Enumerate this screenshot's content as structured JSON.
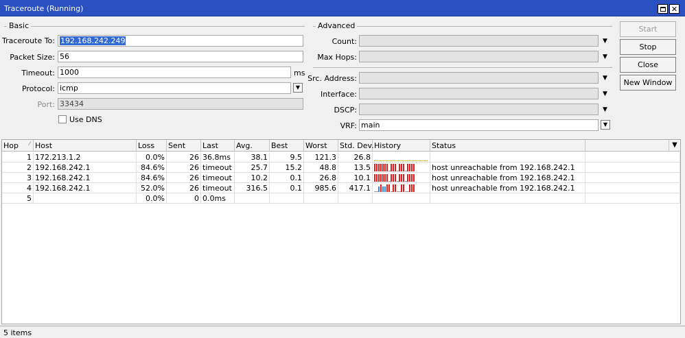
{
  "window": {
    "title": "Traceroute (Running)"
  },
  "basic": {
    "legend": "Basic",
    "traceroute_to_label": "Traceroute To:",
    "traceroute_to_value": "192.168.242.249",
    "packet_size_label": "Packet Size:",
    "packet_size_value": "56",
    "timeout_label": "Timeout:",
    "timeout_value": "1000",
    "timeout_unit": "ms",
    "protocol_label": "Protocol:",
    "protocol_value": "icmp",
    "port_label": "Port:",
    "port_value": "33434",
    "use_dns_label": "Use DNS"
  },
  "advanced": {
    "legend": "Advanced",
    "count_label": "Count:",
    "max_hops_label": "Max Hops:",
    "src_address_label": "Src. Address:",
    "interface_label": "Interface:",
    "dscp_label": "DSCP:",
    "vrf_label": "VRF:",
    "vrf_value": "main"
  },
  "buttons": {
    "start": "Start",
    "stop": "Stop",
    "close": "Close",
    "new_window": "New Window"
  },
  "table": {
    "columns": [
      "Hop",
      "Host",
      "Loss",
      "Sent",
      "Last",
      "Avg.",
      "Best",
      "Worst",
      "Std. Dev.",
      "History",
      "Status"
    ],
    "rows": [
      {
        "hop": "1",
        "host": "172.213.1.2",
        "loss": "0.0%",
        "sent": "26",
        "last": "36.8ms",
        "avg": "38.1",
        "best": "9.5",
        "worst": "121.3",
        "std": "26.8",
        "status": "",
        "history": "none"
      },
      {
        "hop": "2",
        "host": "192.168.242.1",
        "loss": "84.6%",
        "sent": "26",
        "last": "timeout",
        "avg": "25.7",
        "best": "15.2",
        "worst": "48.8",
        "std": "13.5",
        "status": "host unreachable from 192.168.242.1",
        "history": "rrrrrrr_rrr_rrr_rrrr"
      },
      {
        "hop": "3",
        "host": "192.168.242.1",
        "loss": "84.6%",
        "sent": "26",
        "last": "timeout",
        "avg": "10.2",
        "best": "0.1",
        "worst": "26.8",
        "std": "10.1",
        "status": "host unreachable from 192.168.242.1",
        "history": "rrrrrrr_rrr_rrr_rrrr"
      },
      {
        "hop": "4",
        "host": "192.168.242.1",
        "loss": "52.0%",
        "sent": "26",
        "last": "timeout",
        "avg": "316.5",
        "best": "0.1",
        "worst": "985.6",
        "std": "417.1",
        "status": "host unreachable from 192.168.242.1",
        "history": "__brbbrr_rr__rr__rrr"
      },
      {
        "hop": "5",
        "host": "",
        "loss": "0.0%",
        "sent": "0",
        "last": "0.0ms",
        "avg": "",
        "best": "",
        "worst": "",
        "std": "",
        "status": "",
        "history": ""
      }
    ]
  },
  "status_bar": {
    "text": "5 items"
  },
  "colors": {
    "history_red": "#e21b1b",
    "history_blue": "#3a86d6",
    "titlebar": "#2a4fc0",
    "selection": "#3068d4"
  }
}
